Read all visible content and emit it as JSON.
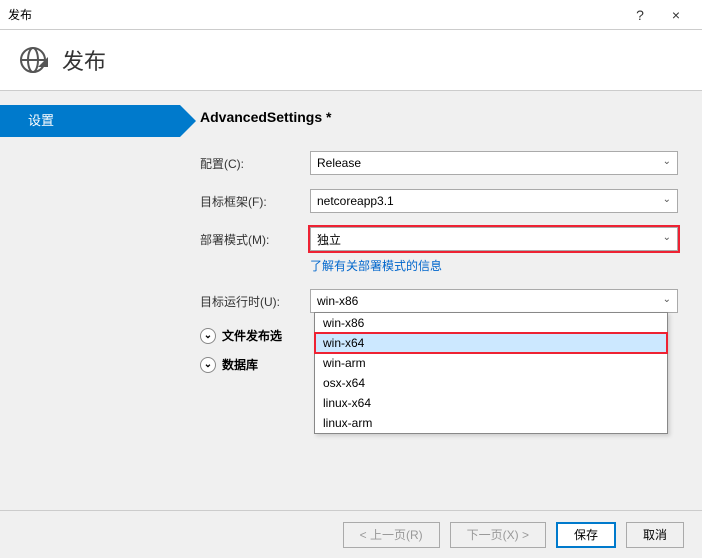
{
  "window": {
    "title": "发布",
    "help": "?",
    "close": "×"
  },
  "header": {
    "title": "发布"
  },
  "sidebar": {
    "step_active": "设置"
  },
  "main": {
    "section_title": "AdvancedSettings *",
    "config_label": "配置(C):",
    "config_value": "Release",
    "framework_label": "目标框架(F):",
    "framework_value": "netcoreapp3.1",
    "deploy_label": "部署模式(M):",
    "deploy_value": "独立",
    "deploy_help": "了解有关部署模式的信息",
    "runtime_label": "目标运行时(U):",
    "runtime_value": "win-x86",
    "runtime_options": [
      "win-x86",
      "win-x64",
      "win-arm",
      "osx-x64",
      "linux-x64",
      "linux-arm"
    ],
    "runtime_selected_index": 1,
    "exp_files": "文件发布选",
    "exp_db": "数据库"
  },
  "footer": {
    "prev": "< 上一页(R)",
    "next": "下一页(X) >",
    "save": "保存",
    "cancel": "取消"
  }
}
